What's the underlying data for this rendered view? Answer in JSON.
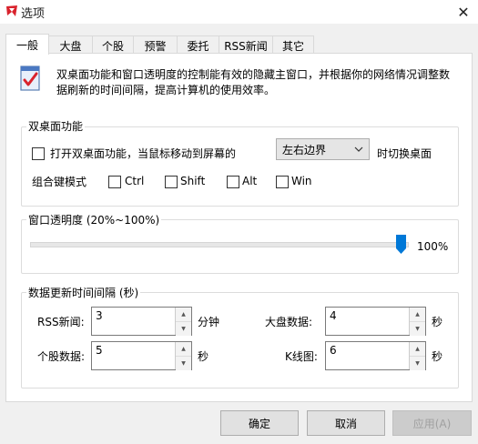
{
  "window": {
    "title": "选项",
    "close_glyph": "✕"
  },
  "tabs": [
    {
      "label": "一般"
    },
    {
      "label": "大盘"
    },
    {
      "label": "个股"
    },
    {
      "label": "预警"
    },
    {
      "label": "委托"
    },
    {
      "label": "RSS新闻"
    },
    {
      "label": "其它"
    }
  ],
  "info": {
    "text": "双桌面功能和窗口透明度的控制能有效的隐藏主窗口，并根据你的网络情况调整数据刷新的时间间隔，提高计算机的使用效率。",
    "icon": "checklist-icon"
  },
  "dual_desktop": {
    "legend": "双桌面功能",
    "enable_label": "打开双桌面功能，当鼠标移动到屏幕的",
    "edge_select": "左右边界",
    "switch_label": "时切换桌面",
    "hotkey_label": "组合键模式",
    "keys": [
      "Ctrl",
      "Shift",
      "Alt",
      "Win"
    ]
  },
  "transparency": {
    "legend": "窗口透明度 (20%~100%)",
    "value_text": "100%",
    "level": 1.0
  },
  "refresh": {
    "legend": "数据更新时间间隔 (秒)",
    "rss_label": "RSS新闻:",
    "rss_value": "3",
    "rss_unit": "分钟",
    "index_label": "大盘数据:",
    "index_value": "4",
    "index_unit": "秒",
    "stock_label": "个股数据:",
    "stock_value": "5",
    "stock_unit": "秒",
    "kline_label": "K线图:",
    "kline_value": "6",
    "kline_unit": "秒"
  },
  "buttons": {
    "ok": "确定",
    "cancel": "取消",
    "apply": "应用(A)"
  },
  "colors": {
    "slider_thumb": "#0078d7",
    "app_icon": "#d9232d"
  }
}
